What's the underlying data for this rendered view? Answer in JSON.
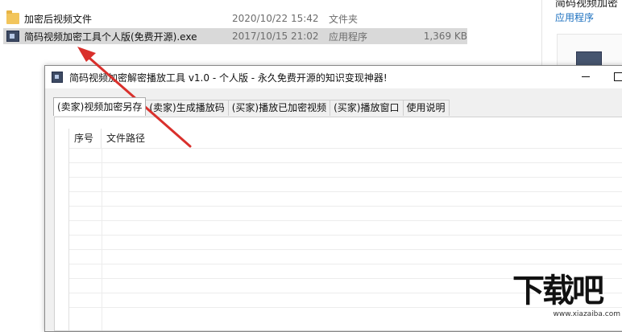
{
  "explorer": {
    "files": [
      {
        "name": "加密后视频文件",
        "date": "2020/10/22 15:42",
        "type": "文件夹",
        "size": "",
        "icon": "folder-icon"
      },
      {
        "name": "简码视频加密工具个人版(免费开源).exe",
        "date": "2017/10/15 21:02",
        "type": "应用程序",
        "size": "1,369 KB",
        "icon": "app-exe-icon"
      }
    ],
    "preview": {
      "title": "简码视频加密",
      "type": "应用程序"
    }
  },
  "window": {
    "title": "简码视频加密解密播放工具 v1.0 - 个人版 - 永久免费开源的知识变现神器!",
    "tabs": [
      {
        "label": "(卖家)视频加密另存",
        "active": true
      },
      {
        "label": "(卖家)生成播放码",
        "active": false
      },
      {
        "label": "(买家)播放已加密视频",
        "active": false
      },
      {
        "label": "(买家)播放窗口",
        "active": false
      },
      {
        "label": "使用说明",
        "active": false
      }
    ],
    "grid": {
      "columns": [
        "序号",
        "文件路径"
      ],
      "rows": []
    }
  },
  "watermark": {
    "text": "下载吧",
    "url": "www.xiazaiba.com"
  },
  "colors": {
    "arrow": "#d9302c",
    "selected_row": "#d9d9d9",
    "link_blue": "#1a6fbf"
  }
}
